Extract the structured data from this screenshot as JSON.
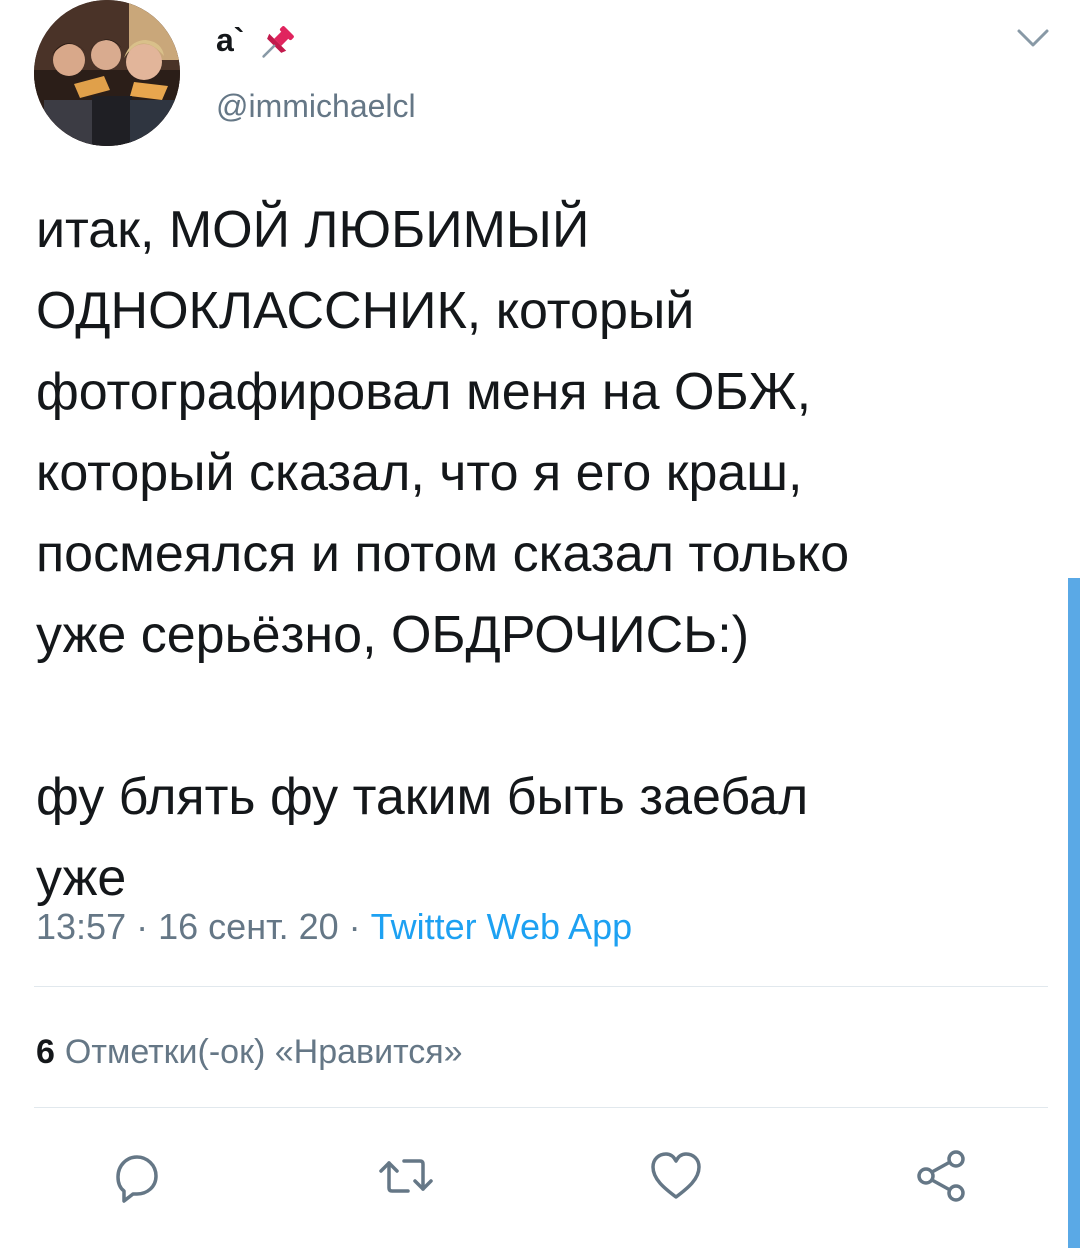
{
  "tweet": {
    "display_name": "a`",
    "handle": "@immichaelcl",
    "text": "итак, МОЙ ЛЮБИМЫЙ\nОДНОКЛАССНИК, который\nфотографировал меня на ОБЖ,\nкоторый сказал, что я его краш,\nпосмеялся и потом сказал только\nуже серьёзно, ОБДРОЧИСЬ:)\n\nфу блять фу таким быть заебал\nуже",
    "time": "13:57",
    "date": "16 сент. 20",
    "separator": "·",
    "source": "Twitter Web App",
    "likes_count": "6",
    "likes_label": "Отметки(-ок) «Нравится»"
  },
  "icons": {
    "pin": "pushpin-icon",
    "menu": "chevron-down-icon",
    "reply": "reply-icon",
    "retweet": "retweet-icon",
    "like": "heart-icon",
    "share": "share-icon"
  },
  "colors": {
    "text": "#14171a",
    "secondary": "#657786",
    "link": "#1da1f2",
    "divider": "#e1e8ed",
    "pin": "#e0245e",
    "scrollbar": "#5aa9e6"
  }
}
